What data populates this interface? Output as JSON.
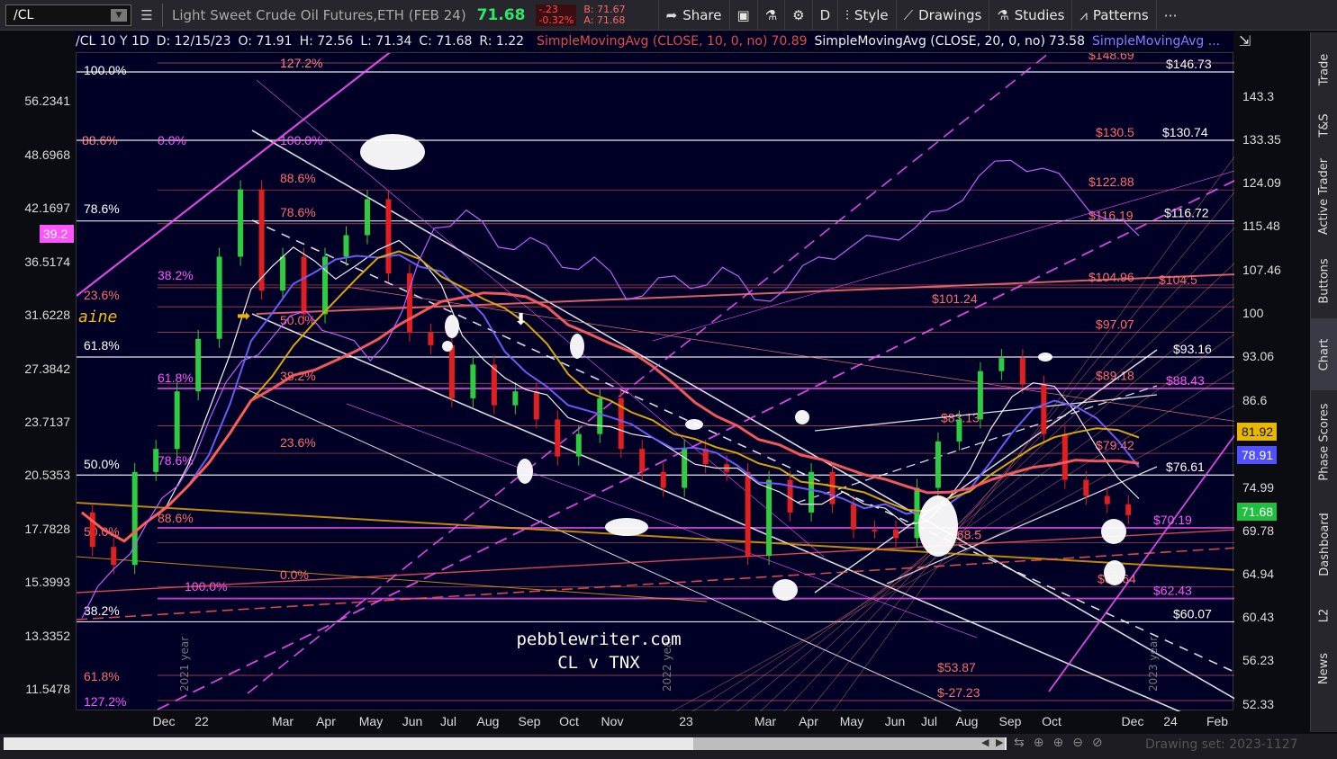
{
  "toolbar": {
    "symbol": "/CL",
    "description": "Light Sweet Crude Oil Futures,ETH (FEB 24)",
    "last": "71.68",
    "change": "-.23",
    "change_pct": "-0.32%",
    "bid": "B: 71.67",
    "ask": "A: 71.68",
    "share": "Share",
    "timeframe": "D",
    "style": "Style",
    "drawings": "Drawings",
    "studies": "Studies",
    "patterns": "Patterns"
  },
  "inforow": {
    "symbol_tf": "/CL 10 Y 1D",
    "date": "D: 12/15/23",
    "open": "O: 71.91",
    "high": "H: 72.56",
    "low": "L: 71.34",
    "close": "C: 71.68",
    "range": "R: 1.22",
    "sma10": "SimpleMovingAvg (CLOSE, 10, 0, no)",
    "sma10_val": "70.89",
    "sma20": "SimpleMovingAvg (CLOSE, 20, 0, no)",
    "sma20_val": "73.58",
    "sma3": "SimpleMovingAvg ..."
  },
  "sidebar": [
    "Trade",
    "T&S",
    "Active Trader",
    "Buttons",
    "Chart",
    "Phase Scores",
    "Dashboard",
    "L2",
    "News"
  ],
  "drawing_set": "Drawing set: 2023-1127",
  "watermark": [
    "pebblewriter.com",
    "CL v TNX"
  ],
  "colors": {
    "bg": "#000026",
    "price_up": "#2ecc40",
    "price_down": "#e02020",
    "sma_red": "#ff5c5c",
    "sma_gold": "#e0b000",
    "sma_blue": "#7060ff",
    "tnx": "#c060ff",
    "magenta": "#ff55ff",
    "last_badge": "#1fbf3f"
  },
  "chart_data": {
    "type": "line",
    "title": "/CL 10 Y 1D",
    "x_labels": [
      "Dec",
      "22",
      "Mar",
      "Apr",
      "May",
      "Jun",
      "Jul",
      "Aug",
      "Sep",
      "Oct",
      "Nov",
      "23",
      "Mar",
      "Apr",
      "May",
      "Jun",
      "Jul",
      "Aug",
      "Sep",
      "Oct",
      "Dec",
      "24",
      "Feb"
    ],
    "y_ticks_right": [
      "143.3",
      "133.35",
      "124.09",
      "115.48",
      "107.46",
      "100",
      "93.06",
      "86.6",
      "81.92",
      "74.99",
      "69.78",
      "64.94",
      "60.43",
      "56.23",
      "52.33"
    ],
    "y_ticks_left": [
      "56.2341",
      "48.6968",
      "42.1697",
      "36.5174",
      "31.6228",
      "27.3842",
      "23.7137",
      "20.5353",
      "17.7828",
      "15.3993",
      "13.3352",
      "11.5478"
    ],
    "left_badge": "39.2",
    "right_badges": [
      {
        "label": "81.92",
        "color": "#e8b800"
      },
      {
        "label": "78.91",
        "color": "#5050ff"
      },
      {
        "label": "71.68",
        "color": "#1fbf3f"
      }
    ],
    "year_marks": [
      "2021 year",
      "2022 year",
      "2023 year"
    ],
    "price_series": {
      "name": "/CL",
      "values": [
        72,
        68,
        66,
        77,
        80,
        88,
        96,
        110,
        123,
        104,
        110,
        100,
        110,
        114,
        121,
        107,
        97,
        95,
        87,
        92,
        86,
        88,
        84,
        79,
        82,
        87,
        80,
        77,
        75,
        80,
        78,
        77,
        67,
        76,
        72,
        77,
        73,
        70,
        70,
        69,
        75,
        81,
        84,
        91,
        93,
        89,
        82,
        76,
        74,
        73,
        71.68
      ]
    },
    "tnx_series": {
      "name": "TNX",
      "values": [
        14,
        16,
        18,
        20,
        24,
        28,
        30,
        32,
        30,
        28,
        32,
        40,
        42,
        38,
        39,
        36,
        37,
        33,
        35,
        34,
        36,
        33,
        34,
        37,
        38,
        39,
        40,
        42,
        46,
        48,
        47,
        44,
        41,
        39.2
      ]
    },
    "horizontal_levels": [
      {
        "label": "$146.73",
        "price": 146.73
      },
      {
        "label": "$148.69",
        "price": 148.69
      },
      {
        "label": "$130.5",
        "price": 130.5
      },
      {
        "label": "$130.74",
        "price": 130.74
      },
      {
        "label": "$122.88",
        "price": 122.88
      },
      {
        "label": "$116.19",
        "price": 116.19
      },
      {
        "label": "$116.72",
        "price": 116.72
      },
      {
        "label": "$104.96",
        "price": 104.96
      },
      {
        "label": "$104.5",
        "price": 104.5
      },
      {
        "label": "$101.24",
        "price": 101.24
      },
      {
        "label": "$97.07",
        "price": 97.07
      },
      {
        "label": "$93.16",
        "price": 93.16
      },
      {
        "label": "$89.18",
        "price": 89.18
      },
      {
        "label": "$88.43",
        "price": 88.43
      },
      {
        "label": "$83.13",
        "price": 83.13
      },
      {
        "label": "$79.42",
        "price": 79.42
      },
      {
        "label": "$76.61",
        "price": 76.61
      },
      {
        "label": "$70.19",
        "price": 70.19
      },
      {
        "label": "$68.5",
        "price": 68.5
      },
      {
        "label": "$63.64",
        "price": 63.64
      },
      {
        "label": "$62.43",
        "price": 62.43
      },
      {
        "label": "$60.07",
        "price": 60.07
      },
      {
        "label": "$53.87",
        "price": 53.87
      },
      {
        "label": "$-27.23",
        "price": -27.23
      }
    ],
    "fib_labels": [
      "100.0%",
      "88.6%",
      "0.0%",
      "78.6%",
      "38.2%",
      "23.6%",
      "61.8%",
      "50.0%",
      "127.2%",
      "100.0%",
      "88.6%",
      "78.6%",
      "61.8%",
      "50.0%",
      "38.2%",
      "23.6%",
      "78.6%",
      "88.6%",
      "50.0%",
      "0.0%",
      "100.0%",
      "38.2%",
      "61.8%",
      "127.2%"
    ],
    "annotation": "aine"
  }
}
